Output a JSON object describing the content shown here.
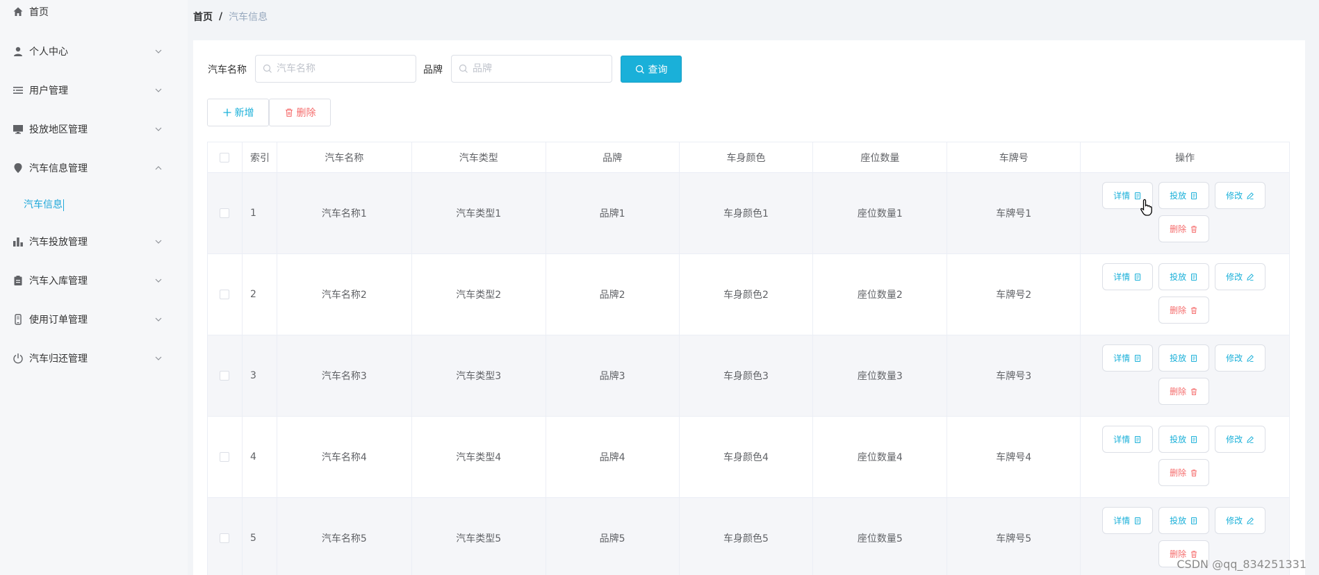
{
  "sidebar": {
    "items": [
      {
        "label": "首页",
        "icon": "home-icon",
        "has_arrow": false
      },
      {
        "label": "个人中心",
        "icon": "user-icon",
        "has_arrow": true,
        "arrow": "down"
      },
      {
        "label": "用户管理",
        "icon": "list-icon",
        "has_arrow": true,
        "arrow": "down"
      },
      {
        "label": "投放地区管理",
        "icon": "monitor-icon",
        "has_arrow": true,
        "arrow": "down"
      },
      {
        "label": "汽车信息管理",
        "icon": "location-icon",
        "has_arrow": true,
        "arrow": "up"
      },
      {
        "label": "汽车投放管理",
        "icon": "bar-chart-icon",
        "has_arrow": true,
        "arrow": "down"
      },
      {
        "label": "汽车入库管理",
        "icon": "clipboard-icon",
        "has_arrow": true,
        "arrow": "down"
      },
      {
        "label": "使用订单管理",
        "icon": "phone-icon",
        "has_arrow": true,
        "arrow": "down"
      },
      {
        "label": "汽车归还管理",
        "icon": "power-icon",
        "has_arrow": true,
        "arrow": "down"
      }
    ],
    "submenu_active": "汽车信息"
  },
  "breadcrumb": {
    "home": "首页",
    "sep": "/",
    "current": "汽车信息"
  },
  "search": {
    "name_label": "汽车名称",
    "name_placeholder": "汽车名称",
    "brand_label": "品牌",
    "brand_placeholder": "品牌",
    "query_label": "查询"
  },
  "actions": {
    "add_label": "新增",
    "delete_label": "删除"
  },
  "table": {
    "headers": [
      "索引",
      "汽车名称",
      "汽车类型",
      "品牌",
      "车身颜色",
      "座位数量",
      "车牌号",
      "操作"
    ],
    "rows": [
      {
        "index": "1",
        "name": "汽车名称1",
        "type": "汽车类型1",
        "brand": "品牌1",
        "color": "车身颜色1",
        "seats": "座位数量1",
        "plate": "车牌号1"
      },
      {
        "index": "2",
        "name": "汽车名称2",
        "type": "汽车类型2",
        "brand": "品牌2",
        "color": "车身颜色2",
        "seats": "座位数量2",
        "plate": "车牌号2"
      },
      {
        "index": "3",
        "name": "汽车名称3",
        "type": "汽车类型3",
        "brand": "品牌3",
        "color": "车身颜色3",
        "seats": "座位数量3",
        "plate": "车牌号3"
      },
      {
        "index": "4",
        "name": "汽车名称4",
        "type": "汽车类型4",
        "brand": "品牌4",
        "color": "车身颜色4",
        "seats": "座位数量4",
        "plate": "车牌号4"
      },
      {
        "index": "5",
        "name": "汽车名称5",
        "type": "汽车类型5",
        "brand": "品牌5",
        "color": "车身颜色5",
        "seats": "座位数量5",
        "plate": "车牌号5"
      }
    ],
    "op_labels": {
      "detail": "详情",
      "deploy": "投放",
      "edit": "修改",
      "delete": "删除"
    }
  },
  "watermark": "CSDN @qq_834251331",
  "colors": {
    "accent": "#1ab0d9",
    "danger": "#f56c6c",
    "stripe": "#f5f6f9"
  }
}
